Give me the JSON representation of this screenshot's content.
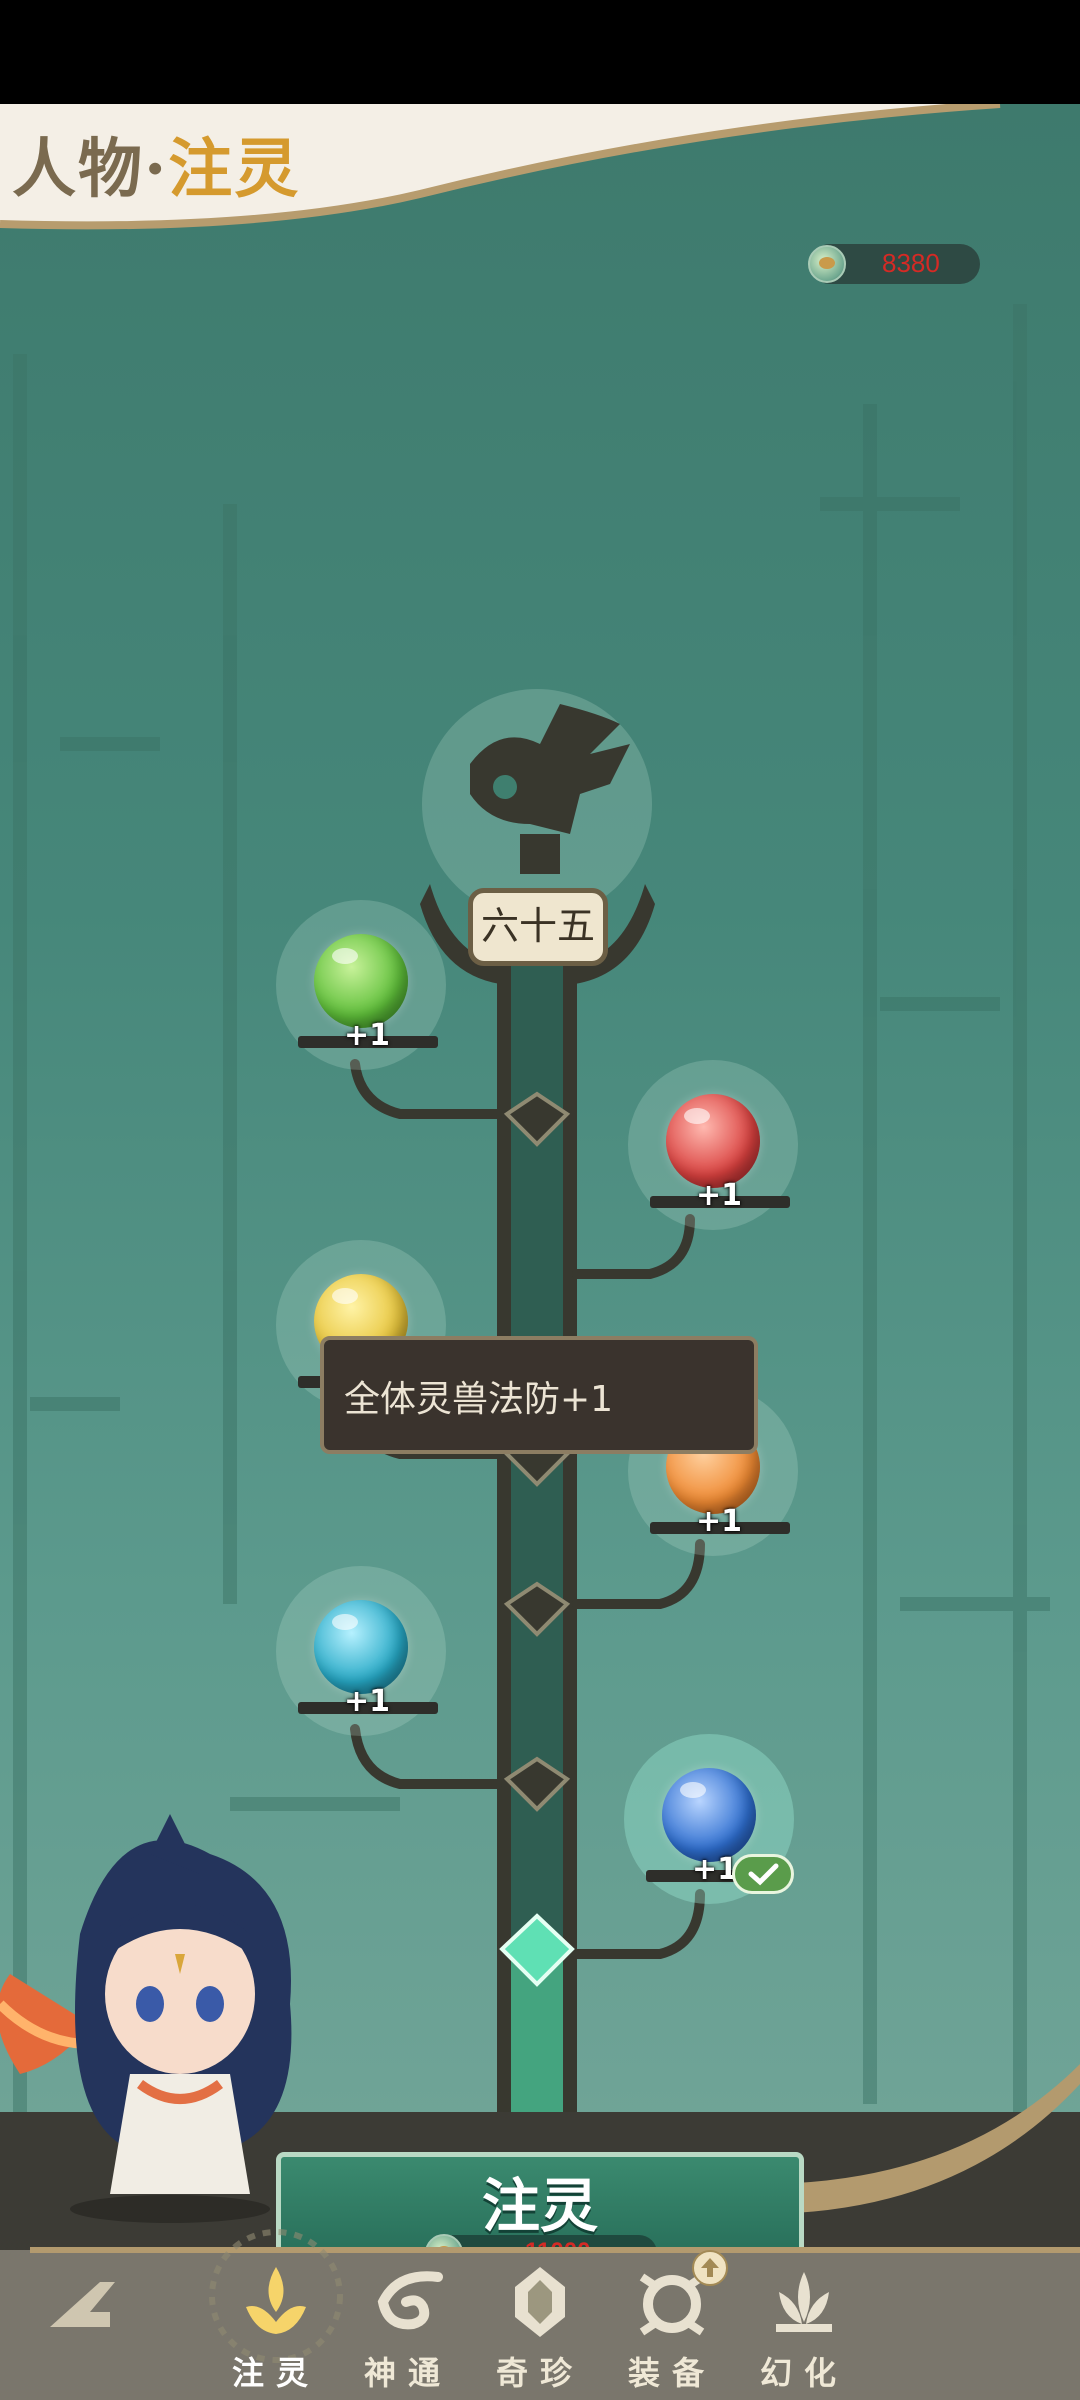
{
  "header": {
    "title_prefix": "人物·",
    "title_main": "注灵"
  },
  "currency": {
    "icon": "spirit-coin-icon",
    "amount": "8380"
  },
  "tree": {
    "level_label": "六十五",
    "nodes": [
      {
        "name": "green-wind-orb",
        "bonus": "+1",
        "color": "#5fbf3a",
        "icon": "wind-icon"
      },
      {
        "name": "red-heart-orb",
        "bonus": "+1",
        "color": "#d9413f",
        "icon": "heart-icon"
      },
      {
        "name": "yellow-orb",
        "bonus": "+1",
        "color": "#e7c53c",
        "icon": "star-icon"
      },
      {
        "name": "orange-shield-orb",
        "bonus": "+1",
        "color": "#ef8a33",
        "icon": "shield-icon"
      },
      {
        "name": "cyan-claw-orb",
        "bonus": "+1",
        "color": "#27a9c6",
        "icon": "claw-icon"
      },
      {
        "name": "blue-swirl-orb",
        "bonus": "+1",
        "color": "#2f6fd0",
        "icon": "swirl-icon",
        "completed": true
      }
    ]
  },
  "tooltip": {
    "text": "全体灵兽法防+1"
  },
  "action": {
    "label": "注灵",
    "cost": "11000"
  },
  "nav": {
    "items": [
      {
        "label": "",
        "icon": "back-arrow-icon"
      },
      {
        "label": "注灵",
        "icon": "lotus-flame-icon",
        "active": true
      },
      {
        "label": "神通",
        "icon": "vortex-icon"
      },
      {
        "label": "奇珍",
        "icon": "gem-icon"
      },
      {
        "label": "装备",
        "icon": "gear-ring-icon",
        "badge": true
      },
      {
        "label": "幻化",
        "icon": "lotus-icon"
      }
    ]
  },
  "colors": {
    "accent_gold": "#d59a2e",
    "bg_green": "#46877a",
    "cost_red": "#d52a25"
  }
}
